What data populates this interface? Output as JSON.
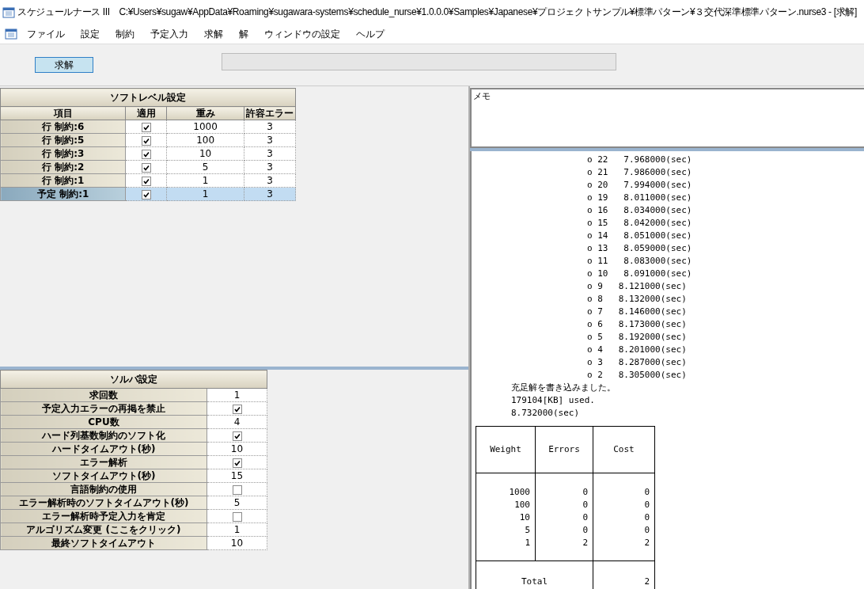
{
  "window": {
    "title": "スケジュールナース III　C:¥Users¥sugaw¥AppData¥Roaming¥sugawara-systems¥schedule_nurse¥1.0.0.0¥Samples¥Japanese¥プロジェクトサンプル¥標準パターン¥３交代深準標準パターン.nurse3 - [求解]"
  },
  "menu": [
    "ファイル",
    "設定",
    "制約",
    "予定入力",
    "求解",
    "解",
    "ウィンドウの設定",
    "ヘルプ"
  ],
  "toolbar": {
    "solve_button": "求解",
    "progress": {
      "level": 0
    }
  },
  "soft_level": {
    "title": "ソフトレベル設定",
    "columns": [
      "項目",
      "適用",
      "重み",
      "許容エラー"
    ],
    "rows": [
      {
        "item": "行 制約:6",
        "checked": true,
        "weight": "1000",
        "allowed_errors": "3",
        "selected": false
      },
      {
        "item": "行 制約:5",
        "checked": true,
        "weight": "100",
        "allowed_errors": "3",
        "selected": false
      },
      {
        "item": "行 制約:3",
        "checked": true,
        "weight": "10",
        "allowed_errors": "3",
        "selected": false
      },
      {
        "item": "行 制約:2",
        "checked": true,
        "weight": "5",
        "allowed_errors": "3",
        "selected": false
      },
      {
        "item": "行 制約:1",
        "checked": true,
        "weight": "1",
        "allowed_errors": "3",
        "selected": false
      },
      {
        "item": "予定 制約:1",
        "checked": true,
        "weight": "1",
        "allowed_errors": "3",
        "selected": true
      }
    ]
  },
  "solver": {
    "title": "ソルバ設定",
    "rows": [
      {
        "label": "求回数",
        "kind": "value",
        "value": "1"
      },
      {
        "label": "予定入力エラーの再掲を禁止",
        "kind": "check",
        "checked": true
      },
      {
        "label": "CPU数",
        "kind": "value",
        "value": "4"
      },
      {
        "label": "ハード列基数制約のソフト化",
        "kind": "check",
        "checked": true
      },
      {
        "label": "ハードタイムアウト(秒)",
        "kind": "value",
        "value": "10"
      },
      {
        "label": "エラー解析",
        "kind": "check",
        "checked": true
      },
      {
        "label": "ソフトタイムアウト(秒)",
        "kind": "value",
        "value": "15"
      },
      {
        "label": "言語制約の使用",
        "kind": "check",
        "checked": false
      },
      {
        "label": "エラー解析時のソフトタイムアウト(秒)",
        "kind": "value",
        "value": "5"
      },
      {
        "label": "エラー解析時予定入力を肯定",
        "kind": "check",
        "checked": false
      },
      {
        "label": "アルゴリズム変更 (ここをクリック)",
        "kind": "value",
        "value": "1"
      },
      {
        "label": "最終ソフトタイムアウト",
        "kind": "value",
        "value": "10"
      }
    ]
  },
  "memo": {
    "text": "メモ"
  },
  "log": {
    "progress_lines": [
      "o 22   7.968000(sec)",
      "o 21   7.986000(sec)",
      "o 20   7.994000(sec)",
      "o 19   8.011000(sec)",
      "o 16   8.034000(sec)",
      "o 15   8.042000(sec)",
      "o 14   8.051000(sec)",
      "o 13   8.059000(sec)",
      "o 11   8.083000(sec)",
      "o 10   8.091000(sec)",
      "o 9   8.121000(sec)",
      "o 8   8.132000(sec)",
      "o 7   8.146000(sec)",
      "o 6   8.173000(sec)",
      "o 5   8.192000(sec)",
      "o 4   8.201000(sec)",
      "o 3   8.287000(sec)",
      "o 2   8.305000(sec)"
    ],
    "summary_lines": [
      "充足解を書き込みました。",
      "179104[KB] used.",
      "8.732000(sec)"
    ],
    "result_table": {
      "columns": [
        "Weight",
        "Errors",
        "Cost"
      ],
      "rows": [
        [
          "1000",
          "0",
          "0"
        ],
        [
          "100",
          "0",
          "0"
        ],
        [
          "10",
          "0",
          "0"
        ],
        [
          "5",
          "0",
          "0"
        ],
        [
          "1",
          "2",
          "2"
        ]
      ],
      "total_label": "Total",
      "total_cost": "2"
    }
  }
}
